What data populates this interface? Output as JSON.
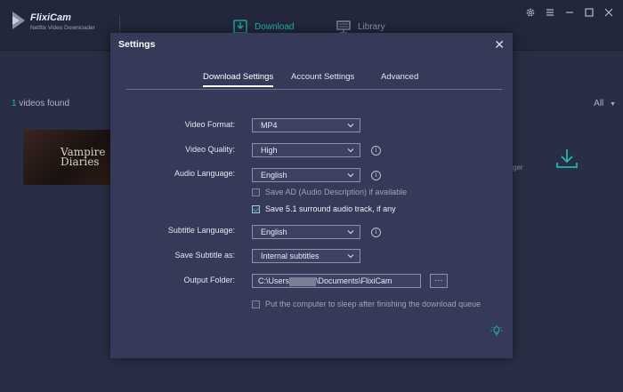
{
  "app": {
    "name": "FlixiCam",
    "subtitle": "Netflix Video Downloader"
  },
  "nav": {
    "download_label": "Download",
    "library_label": "Library"
  },
  "window_icons": [
    "gear-icon",
    "menu-icon",
    "minimize-icon",
    "maximize-icon",
    "close-icon"
  ],
  "main": {
    "found_count": "1",
    "found_text": " videos found",
    "filter_label": "All",
    "thumbnail_title": "Vampire Diaries",
    "partial_text": "ger"
  },
  "settings": {
    "title": "Settings",
    "tabs": [
      {
        "label": "Download Settings",
        "active": true
      },
      {
        "label": "Account Settings",
        "active": false
      },
      {
        "label": "Advanced",
        "active": false
      }
    ],
    "video_format": {
      "label": "Video Format:",
      "value": "MP4"
    },
    "video_quality": {
      "label": "Video Quality:",
      "value": "High"
    },
    "audio_language": {
      "label": "Audio Language:",
      "value": "English"
    },
    "save_ad": {
      "label": "Save AD (Audio Description) if available",
      "checked": false
    },
    "save_51": {
      "label": "Save 5.1 surround audio track, if any",
      "checked": true
    },
    "subtitle_language": {
      "label": "Subtitle Language:",
      "value": "English"
    },
    "save_subtitle": {
      "label": "Save Subtitle as:",
      "value": "Internal subtitles"
    },
    "output_folder": {
      "label": "Output Folder:",
      "value_prefix": "C:\\Users",
      "value_suffix": "\\Documents\\FlixiCam",
      "browse_label": "···"
    },
    "sleep": {
      "label": "Put the computer to sleep after finishing the download queue",
      "checked": false
    }
  },
  "colors": {
    "accent": "#1fb5ad",
    "modal_bg": "#353a58",
    "page_bg": "#2a2e45"
  }
}
